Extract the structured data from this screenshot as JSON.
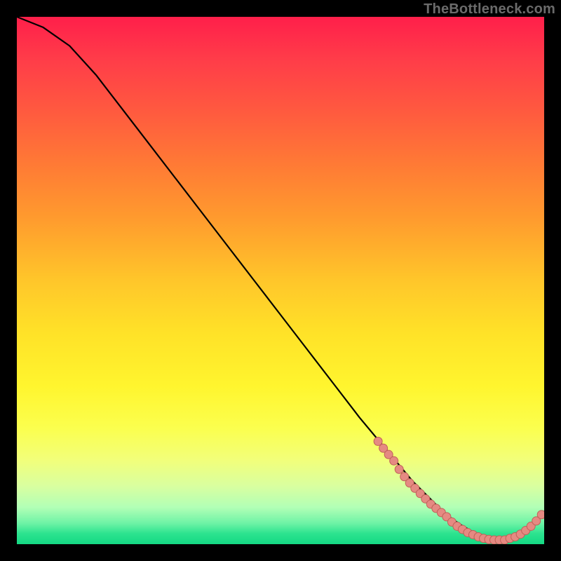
{
  "watermark": "TheBottleneck.com",
  "colors": {
    "background": "#000000",
    "curve": "#000000",
    "marker_fill": "#e58a82",
    "marker_stroke": "#c06058"
  },
  "chart_data": {
    "type": "line",
    "title": "",
    "xlabel": "",
    "ylabel": "",
    "xlim": [
      0,
      100
    ],
    "ylim": [
      0,
      100
    ],
    "curve": {
      "x": [
        0,
        5,
        10,
        15,
        20,
        25,
        30,
        35,
        40,
        45,
        50,
        55,
        60,
        65,
        70,
        75,
        78,
        80,
        82,
        84,
        86,
        88,
        90,
        92,
        94,
        96,
        98,
        100
      ],
      "y": [
        100,
        98,
        94.5,
        89,
        82.5,
        76,
        69.5,
        63,
        56.5,
        50,
        43.5,
        37,
        30.5,
        24,
        18,
        12,
        9,
        7,
        5.2,
        3.8,
        2.6,
        1.6,
        1.0,
        0.7,
        1.2,
        2.2,
        3.8,
        6.2
      ]
    },
    "markers": [
      {
        "x": 68.5,
        "y": 19.5
      },
      {
        "x": 69.5,
        "y": 18.2
      },
      {
        "x": 70.5,
        "y": 17.0
      },
      {
        "x": 71.5,
        "y": 15.8
      },
      {
        "x": 72.5,
        "y": 14.2
      },
      {
        "x": 73.5,
        "y": 12.8
      },
      {
        "x": 74.5,
        "y": 11.6
      },
      {
        "x": 75.5,
        "y": 10.6
      },
      {
        "x": 76.5,
        "y": 9.6
      },
      {
        "x": 77.5,
        "y": 8.6
      },
      {
        "x": 78.5,
        "y": 7.6
      },
      {
        "x": 79.5,
        "y": 6.8
      },
      {
        "x": 80.5,
        "y": 6.0
      },
      {
        "x": 81.5,
        "y": 5.2
      },
      {
        "x": 82.5,
        "y": 4.2
      },
      {
        "x": 83.5,
        "y": 3.4
      },
      {
        "x": 84.5,
        "y": 2.8
      },
      {
        "x": 85.5,
        "y": 2.2
      },
      {
        "x": 86.5,
        "y": 1.8
      },
      {
        "x": 87.5,
        "y": 1.4
      },
      {
        "x": 88.5,
        "y": 1.1
      },
      {
        "x": 89.5,
        "y": 0.9
      },
      {
        "x": 90.5,
        "y": 0.8
      },
      {
        "x": 91.5,
        "y": 0.8
      },
      {
        "x": 92.5,
        "y": 0.8
      },
      {
        "x": 93.5,
        "y": 1.1
      },
      {
        "x": 94.5,
        "y": 1.4
      },
      {
        "x": 95.5,
        "y": 1.9
      },
      {
        "x": 96.5,
        "y": 2.6
      },
      {
        "x": 97.5,
        "y": 3.4
      },
      {
        "x": 98.5,
        "y": 4.4
      },
      {
        "x": 99.5,
        "y": 5.6
      }
    ]
  }
}
